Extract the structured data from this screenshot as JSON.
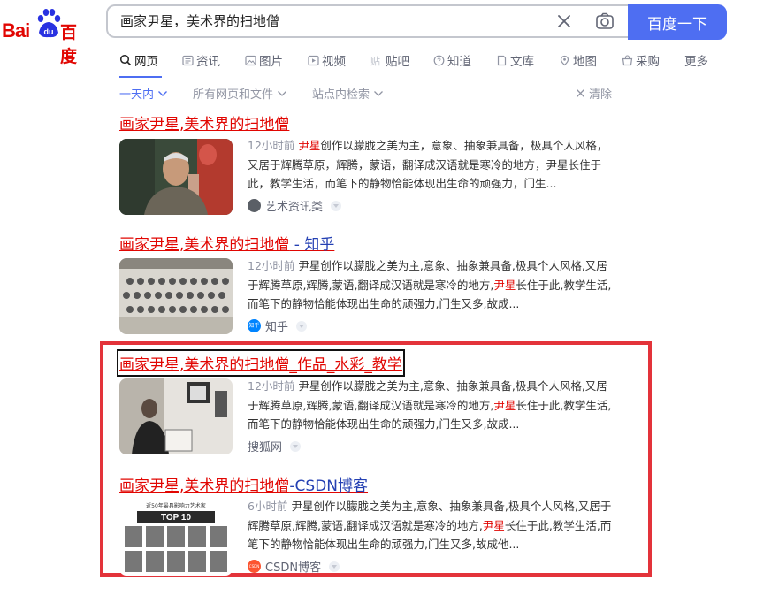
{
  "logo": {
    "part1": "Bai",
    "part2": "百度",
    "paw_text": "du"
  },
  "search": {
    "value": "画家尹星，美术界的扫地僧",
    "submit_label": "百度一下"
  },
  "tabs": [
    {
      "label": "网页",
      "icon": "search-icon",
      "active": true
    },
    {
      "label": "资讯",
      "icon": "news-icon"
    },
    {
      "label": "图片",
      "icon": "image-icon"
    },
    {
      "label": "视频",
      "icon": "video-icon"
    },
    {
      "label": "贴吧",
      "icon": "tieba-icon"
    },
    {
      "label": "知道",
      "icon": "zhidao-icon"
    },
    {
      "label": "文库",
      "icon": "wenku-icon"
    },
    {
      "label": "地图",
      "icon": "map-icon"
    },
    {
      "label": "采购",
      "icon": "shop-icon"
    },
    {
      "label": "更多"
    }
  ],
  "filters": {
    "time": "一天内",
    "filetype": "所有网页和文件",
    "site": "站点内检索",
    "clear": "清除"
  },
  "results": [
    {
      "title_em": "画家尹星,美术界的扫地僧",
      "title_rest": "",
      "time": "12小时前",
      "snippet_parts": [
        "",
        "尹星",
        "创作以朦胧之美为主，意象、抽象兼具备，极具个人风格，又居于辉腾草原，辉腾，蒙语，翻译成汉语就是寒冷的地方，尹星长住于此，教学生活，而笔下的静物恰能体现出生命的顽强力，门生..."
      ],
      "source": "艺术资讯类",
      "source_icon_text": ""
    },
    {
      "title_em": "画家尹星,美术界的扫地僧",
      "title_rest": " - 知乎",
      "time": "12小时前",
      "snippet_parts": [
        "尹星创作以朦胧之美为主,意象、抽象兼具备,极具个人风格,又居于辉腾草原,辉腾,蒙语,翻译成汉语就是寒冷的地方,",
        "尹星",
        "长住于此,教学生活,而笔下的静物恰能体现出生命的顽强力,门生又多,故成..."
      ],
      "source": "知乎",
      "source_icon_text": "知乎"
    },
    {
      "title_em": "画家尹星,美术界的扫地僧",
      "title_rest": "_作品_水彩_教学",
      "time": "12小时前",
      "snippet_parts": [
        "尹星创作以朦胧之美为主,意象、抽象兼具备,极具个人风格,又居于辉腾草原,辉腾,蒙语,翻译成汉语就是寒冷的地方,",
        "尹星",
        "长住于此,教学生活,而笔下的静物恰能体现出生命的顽强力,门生又多,故成..."
      ],
      "source": "搜狐网",
      "source_icon_text": ""
    },
    {
      "title_em": "画家尹星,美术界的扫地僧",
      "title_rest": "-CSDN博客",
      "time": "6小时前",
      "snippet_parts": [
        "尹星创作以朦胧之美为主,意象、抽象兼具备,极具个人风格,又居于辉腾草原,辉腾,蒙语,翻译成汉语就是寒冷的地方,",
        "尹星",
        "长住于此,教学生活,而笔下的静物恰能体现出生命的顽强力,门生又多,故成他..."
      ],
      "source": "CSDN博客",
      "source_icon_text": "CSDN",
      "thumb_text_top": "近50年最具影响力艺术家",
      "thumb_text_top10": "TOP 10"
    }
  ],
  "colors": {
    "accent": "#4e6ef2",
    "brand_red": "#e10602",
    "link": "#2440b3",
    "highlight_box": "#e3333a"
  }
}
